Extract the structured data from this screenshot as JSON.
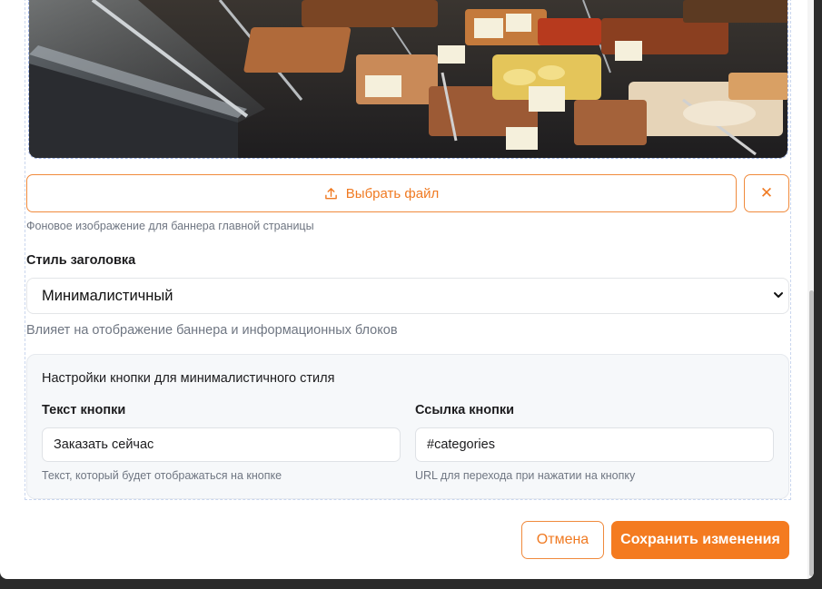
{
  "banner": {
    "image_alt": "deli-counter-photo",
    "choose_file_label": "Выбрать файл",
    "upload_icon": "upload-icon",
    "clear_icon": "close-icon",
    "clear_symbol": "✕",
    "hint": "Фоновое изображение для баннера главной страницы"
  },
  "header_style": {
    "label": "Стиль заголовка",
    "selected": "Минималистичный",
    "hint": "Влияет на отображение баннера и информационных блоков"
  },
  "button_settings": {
    "title": "Настройки кнопки для минималистичного стиля",
    "text_label": "Текст кнопки",
    "text_value": "Заказать сейчас",
    "text_hint": "Текст, который будет отображаться на кнопке",
    "link_label": "Ссылка кнопки",
    "link_value": "#categories",
    "link_hint": "URL для перехода при нажатии на кнопку"
  },
  "footer": {
    "cancel_label": "Отмена",
    "save_label": "Сохранить изменения"
  },
  "colors": {
    "accent": "#f47b20",
    "border_accent": "#f08a3c",
    "muted_text": "#6f7682",
    "panel_bg": "#f6f8fa"
  }
}
